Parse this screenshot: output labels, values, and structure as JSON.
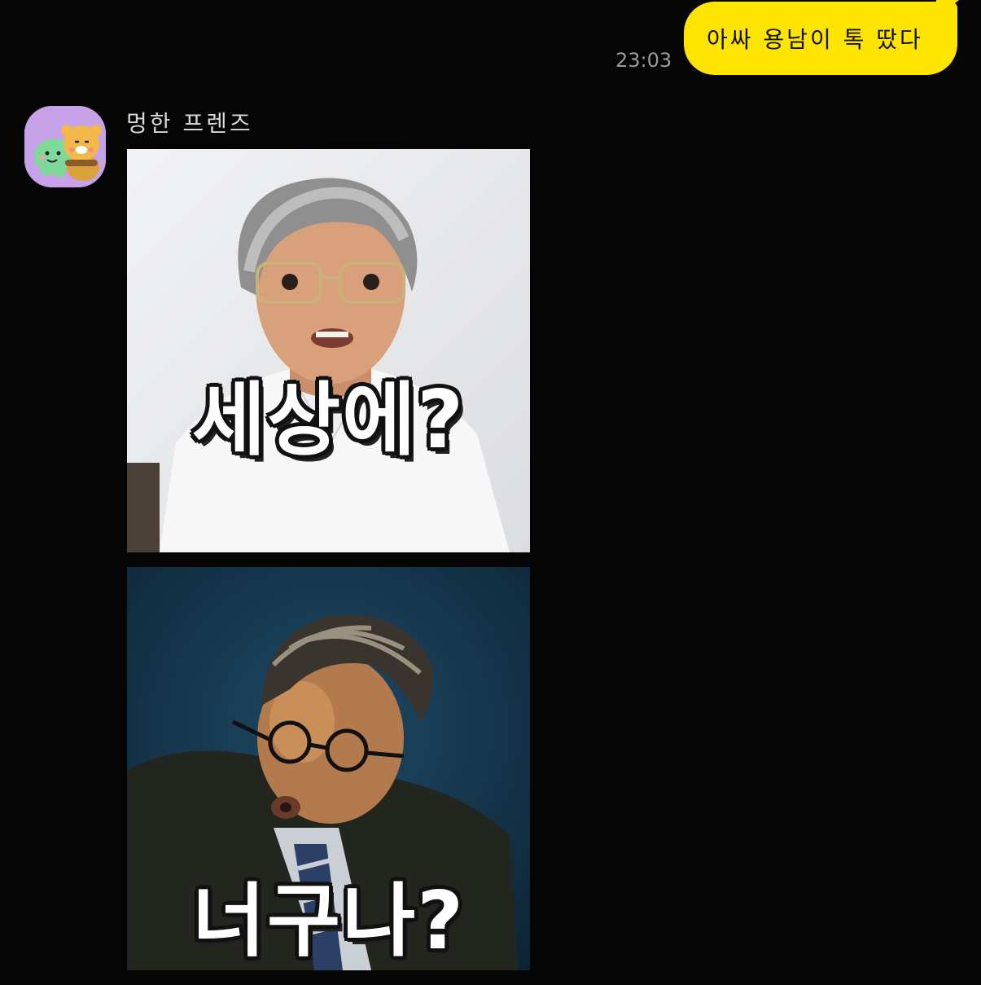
{
  "outgoing": {
    "time": "23:03",
    "text": "아싸 용남이 톡 땄다"
  },
  "incoming": {
    "sender": "멍한 프렌즈",
    "avatar_icon": "friends-character-avatar-icon",
    "stickers": [
      {
        "caption": "세상에?",
        "image": "man-with-gray-wig-and-glasses-sticker"
      },
      {
        "caption": "너구나?",
        "image": "man-in-suit-and-glasses-sticker"
      }
    ]
  },
  "colors": {
    "background": "#050505",
    "bubble": "#fee500",
    "time": "#9a9a9a",
    "sender": "#d8d8d8"
  }
}
